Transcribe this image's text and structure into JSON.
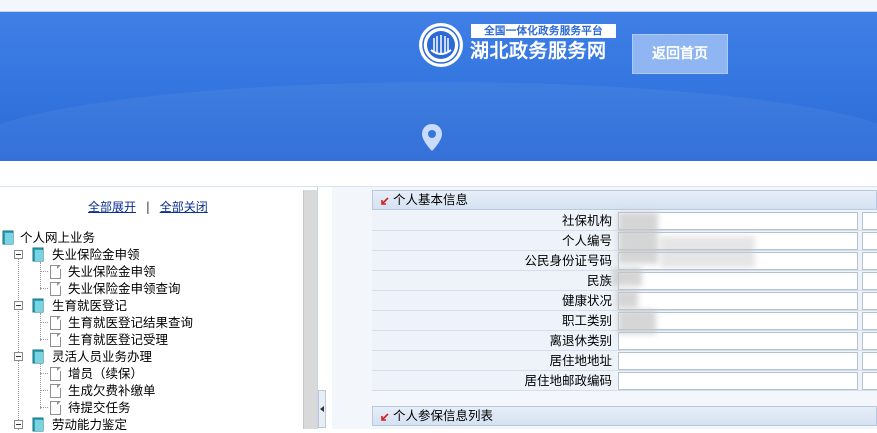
{
  "header": {
    "platform_label": "全国一体化政务服务平台",
    "site_name": "湖北政务服务网",
    "home_button_label": "返回首页",
    "location_icon": "map-pin-icon",
    "colors": {
      "banner": "#3577e0",
      "home_button": "#8fb6f2"
    }
  },
  "sidebar": {
    "expand_all": "全部展开",
    "separator": "|",
    "collapse_all": "全部关闭",
    "tree": {
      "root": "个人网上业务",
      "groups": [
        {
          "label": "失业保险金申领",
          "items": [
            "失业保险金申领",
            "失业保险金申领查询"
          ]
        },
        {
          "label": "生育就医登记",
          "items": [
            "生育就医登记结果查询",
            "生育就医登记受理"
          ]
        },
        {
          "label": "灵活人员业务办理",
          "items": [
            "增员（续保）",
            "生成欠费补缴单",
            "待提交任务"
          ]
        },
        {
          "label": "劳动能力鉴定",
          "items": []
        }
      ]
    }
  },
  "main": {
    "section_basic": "个人基本信息",
    "fields": [
      {
        "label": "社保机构",
        "value": ""
      },
      {
        "label": "个人编号",
        "value": ""
      },
      {
        "label": "公民身份证号码",
        "value": ""
      },
      {
        "label": "民族",
        "value": ""
      },
      {
        "label": "健康状况",
        "value": ""
      },
      {
        "label": "职工类别",
        "value": ""
      },
      {
        "label": "离退休类别",
        "value": ""
      },
      {
        "label": "居住地地址",
        "value": ""
      },
      {
        "label": "居住地邮政编码",
        "value": ""
      }
    ],
    "section_insured": "个人参保信息列表"
  }
}
